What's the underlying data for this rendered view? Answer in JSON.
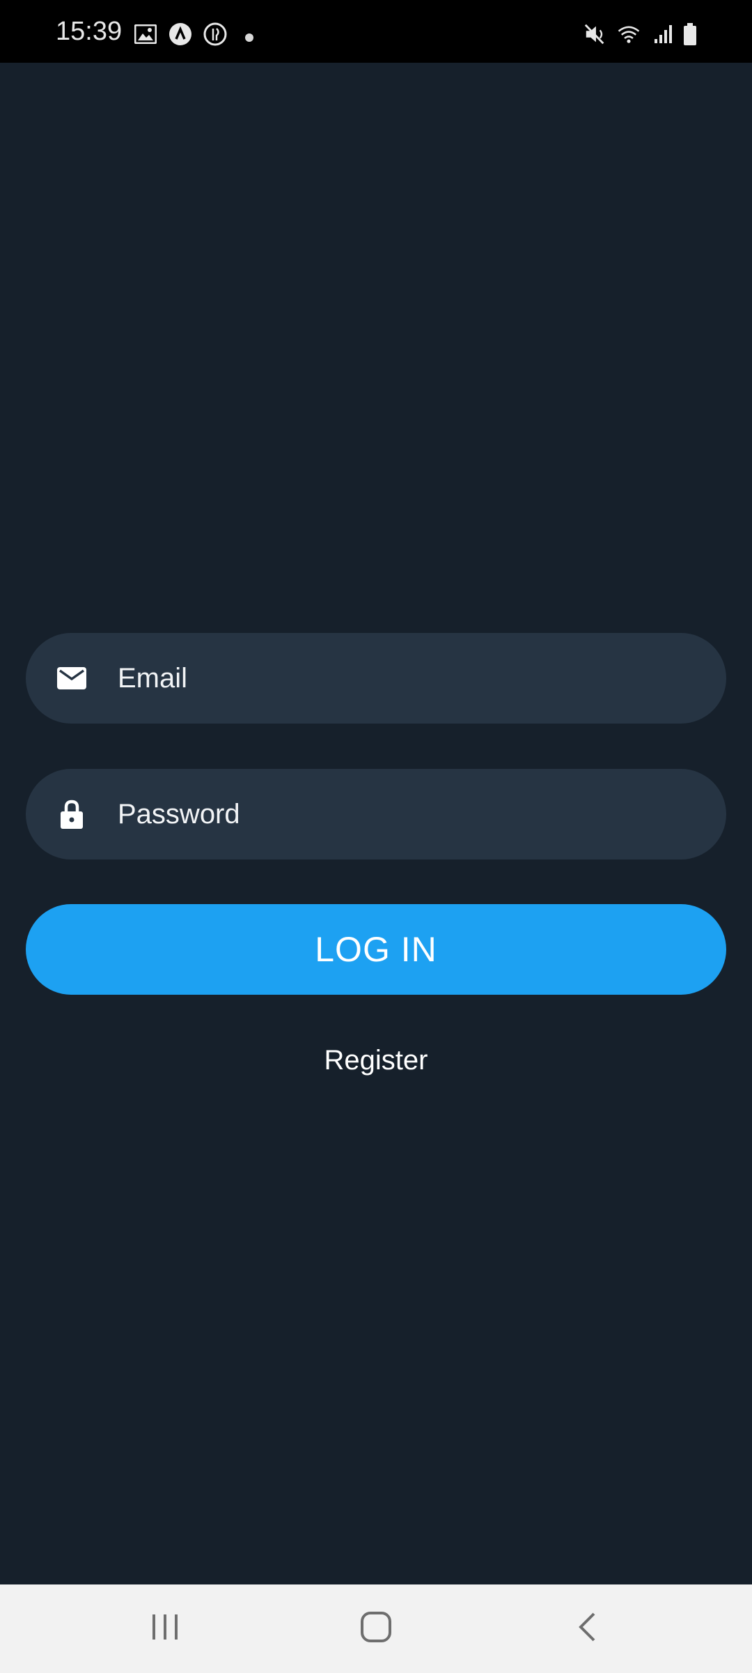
{
  "status_bar": {
    "time": "15:39",
    "left_icons": [
      "gallery-icon",
      "app-a-icon",
      "food-icon"
    ],
    "right_icons": [
      "mute-icon",
      "wifi-icon",
      "signal-icon",
      "battery-icon"
    ]
  },
  "login_form": {
    "email": {
      "icon": "mail-icon",
      "placeholder": "Email",
      "value": ""
    },
    "password": {
      "icon": "lock-icon",
      "placeholder": "Password",
      "value": ""
    },
    "login_label": "LOG IN",
    "register_label": "Register"
  },
  "nav_bar": {
    "buttons": [
      "recent-apps-icon",
      "home-icon",
      "back-icon"
    ]
  },
  "colors": {
    "background": "#16202b",
    "field_background": "#263443",
    "accent": "#1da1f2",
    "status_bar": "#000000",
    "nav_bar": "#f2f2f2"
  }
}
